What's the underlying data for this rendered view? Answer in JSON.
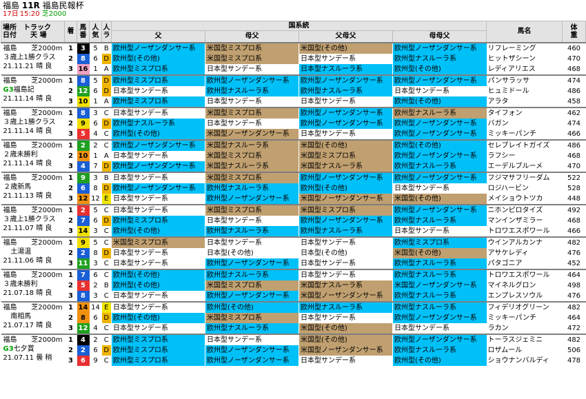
{
  "header": {
    "place": "福島",
    "race": "11R",
    "name": "福島民報杯",
    "day": "17日",
    "time": "15:20",
    "course": "芝2000"
  },
  "columns": {
    "place_date": "場所\n日付",
    "track": "トラック\n天 場",
    "rank": "着",
    "num": "馬番",
    "pop": "人気",
    "ra": "人ラ",
    "lineage": "国系統",
    "sire": "父",
    "dam": "母父",
    "damsire": "父母父",
    "damdam": "母母父",
    "horse": "馬名",
    "weight": "体重"
  },
  "colors": {
    "euro": "#00c0ff",
    "us": "#c09a60",
    "jp": "#ffffff",
    "other_euro": "#00c0ff"
  },
  "races": [
    {
      "place": "福島",
      "dist": "芝2000m",
      "cls": "３歳上1勝クラス",
      "date": "21.11.21",
      "wx": "晴",
      "gd": "良",
      "rows": [
        {
          "rk": "1",
          "no": "3",
          "nc": "w2",
          "pop": "5",
          "ra": "B",
          "lin": [
            "欧州型ノーザンダンサー系",
            "米国型ミスプロ系",
            "米国型(その他)",
            "欧州型ノーザンダンサー系"
          ],
          "lc": [
            "euro",
            "us",
            "us",
            "euro"
          ],
          "h": "リフレーミング",
          "w": "460"
        },
        {
          "rk": "2",
          "no": "8",
          "nc": "w4",
          "pop": "6",
          "ra": "D",
          "lin": [
            "欧州型(その他)",
            "米国型ミスプロ系",
            "日本型サンデー系",
            "欧州型ナスルーラ系"
          ],
          "lc": [
            "euro",
            "us",
            "jp",
            "euro"
          ],
          "h": "ヒットザシーン",
          "w": "470"
        },
        {
          "rk": "3",
          "no": "16",
          "nc": "w8",
          "pop": "1",
          "ra": "A",
          "lin": [
            "欧州型ミスプロ系",
            "日本型サンデー系",
            "日本型ナスルーラ系",
            "欧州型(その他)"
          ],
          "lc": [
            "euro",
            "jp",
            "euro",
            "euro"
          ],
          "h": "レディアリエス",
          "w": "468"
        }
      ]
    },
    {
      "place": "福島",
      "dist": "芝2000m",
      "cls": "G3福島記",
      "date": "21.11.14",
      "wx": "晴",
      "gd": "良",
      "g3": true,
      "rows": [
        {
          "rk": "1",
          "no": "8",
          "nc": "w4",
          "pop": "5",
          "ra": "D",
          "lin": [
            "欧州型ミスプロ系",
            "欧州型ノーザンダンサー系",
            "欧州型ノーザンダンサー系",
            "欧州型ノーザンダンサー系"
          ],
          "lc": [
            "euro",
            "euro",
            "euro",
            "euro"
          ],
          "h": "パンサラッサ",
          "w": "474"
        },
        {
          "rk": "2",
          "no": "12",
          "nc": "w6",
          "pop": "6",
          "ra": "D",
          "lin": [
            "日本型サンデー系",
            "欧州型ナスルーラ系",
            "欧州型ナスルーラ系",
            "日本型サンデー系"
          ],
          "lc": [
            "jp",
            "euro",
            "euro",
            "jp"
          ],
          "h": "ヒュミドール",
          "w": "486"
        },
        {
          "rk": "3",
          "no": "10",
          "nc": "w5",
          "pop": "1",
          "ra": "A",
          "lin": [
            "欧州型ミスプロ系",
            "日本型サンデー系",
            "日本型サンデー系",
            "欧州型(その他)"
          ],
          "lc": [
            "euro",
            "jp",
            "jp",
            "euro"
          ],
          "h": "アラタ",
          "w": "458"
        }
      ]
    },
    {
      "place": "福島",
      "dist": "芝2000m",
      "cls": "３歳上1勝クラス",
      "date": "21.11.14",
      "wx": "晴",
      "gd": "良",
      "rows": [
        {
          "rk": "1",
          "no": "8",
          "nc": "w4",
          "pop": "3",
          "ra": "C",
          "lin": [
            "日本型サンデー系",
            "米国型ミスプロ系",
            "欧州型ノーザンダンサー系",
            "欧州型ナスルーラ系"
          ],
          "lc": [
            "jp",
            "us",
            "euro",
            "us"
          ],
          "h": "タイフォン",
          "w": "462"
        },
        {
          "rk": "2",
          "no": "9",
          "nc": "w5",
          "pop": "6",
          "ra": "D",
          "lin": [
            "欧州型ナスルーラ系",
            "日本型サンデー系",
            "欧州型ノーザンダンサー系",
            "欧州型ノーザンダンサー系"
          ],
          "lc": [
            "euro",
            "jp",
            "euro",
            "euro"
          ],
          "h": "バガン",
          "w": "474"
        },
        {
          "rk": "3",
          "no": "5",
          "nc": "w3",
          "pop": "4",
          "ra": "C",
          "lin": [
            "欧州型(その他)",
            "米国型ノーザンダンサー系",
            "日本型サンデー系",
            "欧州型ノーザンダンサー系"
          ],
          "lc": [
            "euro",
            "us",
            "jp",
            "euro"
          ],
          "h": "ミッキーパンチ",
          "w": "466"
        }
      ]
    },
    {
      "place": "福島",
      "dist": "芝2000m",
      "cls": "２歳未勝利",
      "date": "21.11.14",
      "wx": "晴",
      "gd": "良",
      "rows": [
        {
          "rk": "1",
          "no": "2",
          "nc": "w6",
          "pop": "2",
          "ra": "C",
          "lin": [
            "欧州型ノーザンダンサー系",
            "米国型ナスルーラ系",
            "米国型(その他)",
            "欧州型(その他)"
          ],
          "lc": [
            "euro",
            "us",
            "us",
            "euro"
          ],
          "h": "セレブレイトガイズ",
          "w": "486"
        },
        {
          "rk": "2",
          "no": "10",
          "nc": "w7",
          "pop": "1",
          "ra": "A",
          "lin": [
            "日本型サンデー系",
            "米国型ミスプロ系",
            "米国型ミスプロ系",
            "欧州型ノーザンダンサー系"
          ],
          "lc": [
            "jp",
            "us",
            "us",
            "euro"
          ],
          "h": "ラフシー",
          "w": "468"
        },
        {
          "rk": "3",
          "no": "4",
          "nc": "w4",
          "pop": "7",
          "ra": "D",
          "lin": [
            "欧州型ノーザンダンサー系",
            "米国型ナスルーラ系",
            "米国型ナスルーラ系",
            "欧州型ナスルーラ系"
          ],
          "lc": [
            "euro",
            "us",
            "us",
            "euro"
          ],
          "h": "エーデルブルーメ",
          "w": "470"
        }
      ]
    },
    {
      "place": "福島",
      "dist": "芝2000m",
      "cls": "２歳新馬",
      "date": "21.11.13",
      "wx": "晴",
      "gd": "良",
      "rows": [
        {
          "rk": "1",
          "no": "9",
          "nc": "w6",
          "pop": "3",
          "ra": "B",
          "lin": [
            "日本型サンデー系",
            "米国型ミスプロ系",
            "欧州型ノーザンダンサー系",
            "欧州型ノーザンダンサー系"
          ],
          "lc": [
            "jp",
            "us",
            "euro",
            "euro"
          ],
          "h": "フジマサフリーダム",
          "w": "522"
        },
        {
          "rk": "2",
          "no": "6",
          "nc": "w4",
          "pop": "8",
          "ra": "D",
          "lin": [
            "欧州型ノーザンダンサー系",
            "欧州型ナスルーラ系",
            "欧州型(その他)",
            "日本型サンデー系"
          ],
          "lc": [
            "euro",
            "euro",
            "euro",
            "jp"
          ],
          "h": "ロジハービン",
          "w": "528"
        },
        {
          "rk": "3",
          "no": "12",
          "nc": "w7",
          "pop": "12",
          "ra": "E",
          "lin": [
            "日本型サンデー系",
            "欧州型ノーザンダンサー系",
            "米国型ノーザンダンサー系",
            "米国型(その他)"
          ],
          "lc": [
            "jp",
            "euro",
            "us",
            "us"
          ],
          "h": "メイショウトツカ",
          "w": "448"
        }
      ]
    },
    {
      "place": "福島",
      "dist": "芝2000m",
      "cls": "３歳上1勝クラス",
      "date": "21.11.07",
      "wx": "晴",
      "gd": "良",
      "rows": [
        {
          "rk": "1",
          "no": "2",
          "nc": "w3",
          "pop": "5",
          "ra": "C",
          "lin": [
            "日本型サンデー系",
            "米国型ミスプロ系",
            "米国型ミスプロ系",
            "欧州型ノーザンダンサー系"
          ],
          "lc": [
            "jp",
            "us",
            "us",
            "euro"
          ],
          "h": "ニホンピロタイズ",
          "w": "492"
        },
        {
          "rk": "2",
          "no": "7",
          "nc": "w4",
          "pop": "6",
          "ra": "D",
          "lin": [
            "欧州型ミスプロ系",
            "日本型サンデー系",
            "欧州型ノーザンダンサー系",
            "欧州型ナスルーラ系"
          ],
          "lc": [
            "euro",
            "jp",
            "euro",
            "euro"
          ],
          "h": "マンインザミラー",
          "w": "468"
        },
        {
          "rk": "3",
          "no": "14",
          "nc": "w5",
          "pop": "3",
          "ra": "C",
          "lin": [
            "欧州型(その他)",
            "欧州型ナスルーラ系",
            "欧州型ナスルーラ系",
            "日本型サンデー系"
          ],
          "lc": [
            "euro",
            "euro",
            "euro",
            "jp"
          ],
          "h": "トロワエスポワール",
          "w": "466"
        }
      ]
    },
    {
      "place": "福島",
      "dist": "芝2000m",
      "cls": "土湯温",
      "date": "21.11.06",
      "wx": "晴",
      "gd": "良",
      "rows": [
        {
          "rk": "1",
          "no": "9",
          "nc": "w5",
          "pop": "5",
          "ra": "C",
          "lin": [
            "米国型ミスプロ系",
            "日本型サンデー系",
            "日本型サンデー系",
            "欧州型ミスプロ系"
          ],
          "lc": [
            "us",
            "jp",
            "jp",
            "euro"
          ],
          "h": "ウインアルカンナ",
          "w": "482"
        },
        {
          "rk": "2",
          "no": "2",
          "nc": "w4",
          "pop": "8",
          "ra": "D",
          "lin": [
            "日本型サンデー系",
            "日本型(その他)",
            "日本型(その他)",
            "米国型(その他)"
          ],
          "lc": [
            "jp",
            "jp",
            "jp",
            "us"
          ],
          "h": "アサケレディ",
          "w": "476"
        },
        {
          "rk": "3",
          "no": "11",
          "nc": "w6",
          "pop": "3",
          "ra": "C",
          "lin": [
            "日本型サンデー系",
            "欧州型ノーザンダンサー系",
            "日本型サンデー系",
            "欧州型ナスルーラ系"
          ],
          "lc": [
            "jp",
            "euro",
            "jp",
            "euro"
          ],
          "h": "パタゴニア",
          "w": "452"
        }
      ]
    },
    {
      "place": "福島",
      "dist": "芝2000m",
      "cls": "３歳未勝利",
      "date": "21.07.18",
      "wx": "晴",
      "gd": "良",
      "rows": [
        {
          "rk": "1",
          "no": "7",
          "nc": "w4",
          "pop": "6",
          "ra": "C",
          "lin": [
            "欧州型(その他)",
            "欧州型ナスルーラ系",
            "日本型サンデー系",
            "欧州型ナスルーラ系"
          ],
          "lc": [
            "euro",
            "euro",
            "jp",
            "euro"
          ],
          "h": "トロワエスポワール",
          "w": "464"
        },
        {
          "rk": "2",
          "no": "5",
          "nc": "w3",
          "pop": "2",
          "ra": "B",
          "lin": [
            "欧州型(その他)",
            "米国型ミスプロ系",
            "米国型ナスルーラ系",
            "米国型ノーザンダンサー系"
          ],
          "lc": [
            "euro",
            "us",
            "us",
            "euro"
          ],
          "h": "マイネルグロン",
          "w": "498"
        },
        {
          "rk": "3",
          "no": "8",
          "nc": "w4",
          "pop": "3",
          "ra": "C",
          "lin": [
            "日本型サンデー系",
            "欧州型ノーザンダンサー系",
            "米国型ノーザンダンサー系",
            "欧州型ナスルーラ系"
          ],
          "lc": [
            "jp",
            "euro",
            "us",
            "euro"
          ],
          "h": "エンプレスソウル",
          "w": "476"
        }
      ]
    },
    {
      "place": "福島",
      "dist": "芝2000m",
      "cls": "南相馬",
      "date": "21.07.17",
      "wx": "晴",
      "gd": "良",
      "rows": [
        {
          "rk": "1",
          "no": "14",
          "nc": "w7",
          "pop": "14",
          "ra": "E",
          "lin": [
            "日本型サンデー系",
            "欧州型(その他)",
            "欧州型ナスルーラ系",
            "欧州型ナスルーラ系"
          ],
          "lc": [
            "jp",
            "euro",
            "euro",
            "euro"
          ],
          "h": "フィデリオグリーン",
          "w": "482"
        },
        {
          "rk": "2",
          "no": "8",
          "nc": "w7",
          "pop": "6",
          "ra": "D",
          "lin": [
            "欧州型(その他)",
            "米国型ミスプロ系",
            "日本型サンデー系",
            "欧州型ノーザンダンサー系"
          ],
          "lc": [
            "euro",
            "us",
            "jp",
            "euro"
          ],
          "h": "ミッキーパンチ",
          "w": "464"
        },
        {
          "rk": "3",
          "no": "12",
          "nc": "w6",
          "pop": "4",
          "ra": "C",
          "lin": [
            "日本型サンデー系",
            "欧州型ナスルーラ系",
            "米国型(その他)",
            "日本型サンデー系"
          ],
          "lc": [
            "jp",
            "euro",
            "us",
            "jp"
          ],
          "h": "ラカン",
          "w": "472"
        }
      ]
    },
    {
      "place": "福島",
      "dist": "芝2000m",
      "cls": "G3七夕賞",
      "date": "21.07.11",
      "wx": "曇",
      "gd": "稍",
      "g3": true,
      "rows": [
        {
          "rk": "1",
          "no": "4",
          "nc": "w2",
          "pop": "2",
          "ra": "C",
          "lin": [
            "欧州型ミスプロ系",
            "日本型サンデー系",
            "米国型(その他)",
            "欧州型ノーザンダンサー系"
          ],
          "lc": [
            "euro",
            "jp",
            "us",
            "euro"
          ],
          "h": "トーラスジェミニ",
          "w": "482"
        },
        {
          "rk": "2",
          "no": "2",
          "nc": "w4",
          "pop": "6",
          "ra": "D",
          "lin": [
            "欧州型ミスプロ系",
            "欧州型ノーザンダンサー系",
            "米国型ノーザンダンサー系",
            "欧州型ナスルーラ系"
          ],
          "lc": [
            "euro",
            "euro",
            "us",
            "euro"
          ],
          "h": "ロザムール",
          "w": "506"
        },
        {
          "rk": "3",
          "no": "6",
          "nc": "w3",
          "pop": "9",
          "ra": "C",
          "lin": [
            "欧州型ミスプロ系",
            "欧州型ノーザンダンサー系",
            "日本型サンデー系",
            "欧州型(その他)"
          ],
          "lc": [
            "euro",
            "euro",
            "jp",
            "euro"
          ],
          "h": "ショウナンバルディ",
          "w": "478"
        }
      ]
    }
  ]
}
